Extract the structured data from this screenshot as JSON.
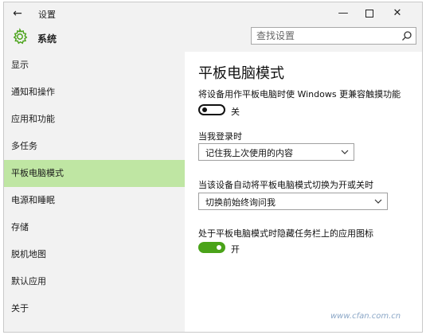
{
  "window": {
    "title": "设置",
    "controls": {
      "minimize": "—",
      "close": "✕"
    }
  },
  "header": {
    "section": "系统",
    "search_placeholder": "查找设置"
  },
  "sidebar": {
    "items": [
      {
        "label": "显示"
      },
      {
        "label": "通知和操作"
      },
      {
        "label": "应用和功能"
      },
      {
        "label": "多任务"
      },
      {
        "label": "平板电脑模式",
        "selected": true
      },
      {
        "label": "电源和睡眠"
      },
      {
        "label": "存储"
      },
      {
        "label": "脱机地图"
      },
      {
        "label": "默认应用"
      },
      {
        "label": "关于"
      }
    ]
  },
  "main": {
    "title": "平板电脑模式",
    "tablet_toggle": {
      "description": "将设备用作平板电脑时使 Windows 更兼容触摸功能",
      "state_label": "关",
      "on": false
    },
    "signin": {
      "label": "当我登录时",
      "value": "记住我上次使用的内容"
    },
    "auto_switch": {
      "label": "当该设备自动将平板电脑模式切换为开或关时",
      "value": "切换前始终询问我"
    },
    "hide_icons_toggle": {
      "description": "处于平板电脑模式时隐藏任务栏上的应用图标",
      "state_label": "开",
      "on": true
    }
  },
  "watermark": "www.cfan.com.cn",
  "colors": {
    "accent": "#4aa319",
    "selected_bg": "#bfe6a3",
    "chrome_bg": "#f2f2f2"
  }
}
